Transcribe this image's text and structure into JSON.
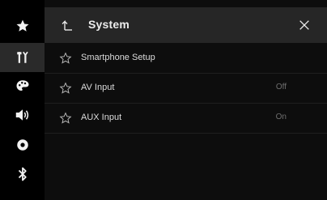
{
  "header": {
    "title": "System",
    "back_icon": "back-arrow-icon",
    "close_icon": "close-icon"
  },
  "sidebar": {
    "items": [
      {
        "icon": "star-icon"
      },
      {
        "icon": "settings-tools-icon",
        "active": true
      },
      {
        "icon": "theme-palette-icon"
      },
      {
        "icon": "audio-speaker-icon"
      },
      {
        "icon": "display-circle-icon"
      },
      {
        "icon": "bluetooth-icon"
      }
    ]
  },
  "list": {
    "items": [
      {
        "label": "Smartphone Setup",
        "value": ""
      },
      {
        "label": "AV Input",
        "value": "Off"
      },
      {
        "label": "AUX Input",
        "value": "On"
      }
    ]
  },
  "colors": {
    "background": "#0d0d0d",
    "header": "#262626",
    "sidebar": "#000000",
    "sidebar_active": "#2a2a2a",
    "text": "#e4e4e4",
    "muted_value": "#6f6f6f"
  }
}
